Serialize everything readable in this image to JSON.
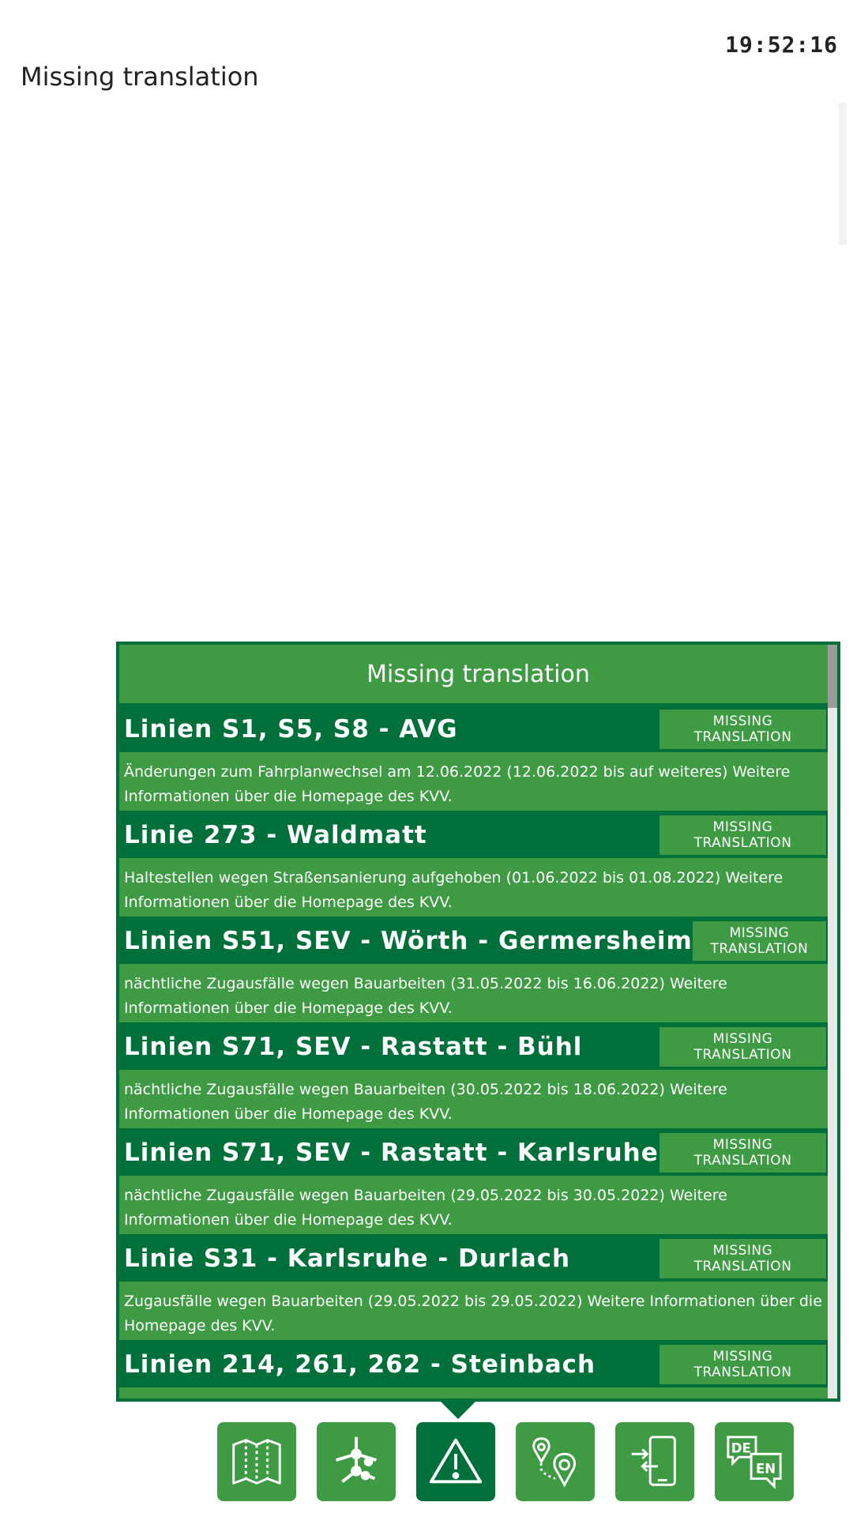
{
  "header": {
    "clock": "19:52:16",
    "title": "Missing translation"
  },
  "panel": {
    "title": "Missing translation",
    "items": [
      {
        "title": "Linien S1, S5, S8 - AVG",
        "button": "MISSING TRANSLATION",
        "description": "Änderungen zum Fahrplanwechsel am 12.06.2022 (12.06.2022 bis auf weiteres) Weitere Informationen über die Homepage des KVV."
      },
      {
        "title": "Linie 273 - Waldmatt",
        "button": "MISSING TRANSLATION",
        "description": "Haltestellen wegen Straßensanierung aufgehoben (01.06.2022 bis 01.08.2022) Weitere Informationen über die Homepage des KVV."
      },
      {
        "title": "Linien S51, SEV - Wörth - Germersheim",
        "button": "MISSING TRANSLATION",
        "description": "nächtliche Zugausfälle wegen Bauarbeiten (31.05.2022 bis 16.06.2022) Weitere Informationen über die Homepage des KVV."
      },
      {
        "title": "Linien S71, SEV - Rastatt - Bühl",
        "button": "MISSING TRANSLATION",
        "description": "nächtliche Zugausfälle wegen Bauarbeiten (30.05.2022 bis 18.06.2022) Weitere Informationen über die Homepage des KVV."
      },
      {
        "title": "Linien S71, SEV - Rastatt - Karlsruhe",
        "button": "MISSING TRANSLATION",
        "description": "nächtliche Zugausfälle wegen Bauarbeiten (29.05.2022 bis 30.05.2022) Weitere Informationen über die Homepage des KVV."
      },
      {
        "title": "Linie S31 - Karlsruhe - Durlach",
        "button": "MISSING TRANSLATION",
        "description": "Zugausfälle wegen Bauarbeiten (29.05.2022 bis 29.05.2022) Weitere Informationen über die Homepage des KVV."
      },
      {
        "title": "Linien 214, 261, 262 - Steinbach",
        "button": "MISSING TRANSLATION",
        "description": ""
      }
    ]
  },
  "nav": {
    "items": [
      {
        "icon": "map-icon"
      },
      {
        "icon": "network-icon"
      },
      {
        "icon": "warning-icon",
        "active": true
      },
      {
        "icon": "route-icon"
      },
      {
        "icon": "phone-transfer-icon"
      },
      {
        "icon": "language-icon",
        "label_de": "DE",
        "label_en": "EN"
      }
    ]
  },
  "colors": {
    "primary": "#3f9a44",
    "dark": "#00703a"
  }
}
